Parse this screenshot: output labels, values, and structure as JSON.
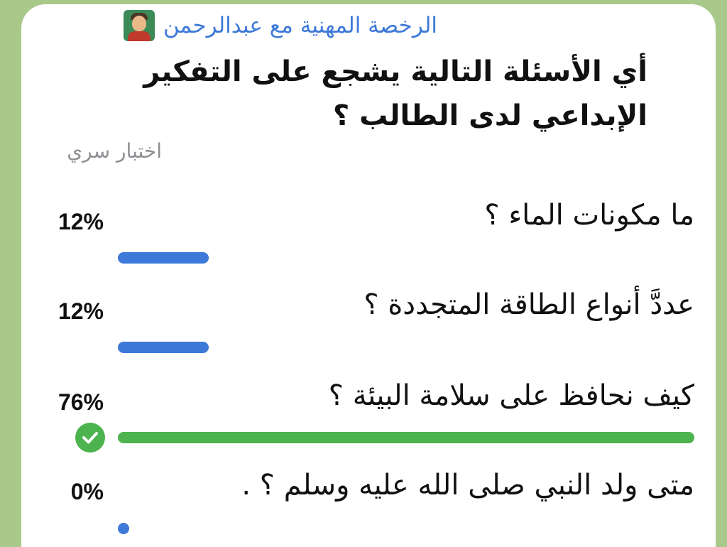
{
  "header": {
    "sender_name": "الرخصة المهنية مع عبدالرحمن",
    "sender_icon": "teacher-emoji-icon"
  },
  "poll": {
    "question": "أي الأسئلة التالية يشجع على التفكير الإبداعي لدى الطالب ؟",
    "type_label": "اختبار سري",
    "bar_color": "#3d79d8",
    "correct_color": "#4db34e",
    "options": [
      {
        "text": "ما مكونات الماء ؟",
        "percent_label": "12%",
        "fraction": 0.12,
        "correct": false
      },
      {
        "text": "عددَّ أنواع الطاقة المتجددة ؟",
        "percent_label": "12%",
        "fraction": 0.12,
        "correct": false
      },
      {
        "text": "كيف نحافظ على سلامة البيئة ؟",
        "percent_label": "76%",
        "fraction": 0.76,
        "correct": true
      },
      {
        "text": "متى ولد النبي صلى الله عليه وسلم ؟ .",
        "percent_label": "0%",
        "fraction": 0.0,
        "correct": false
      }
    ]
  }
}
